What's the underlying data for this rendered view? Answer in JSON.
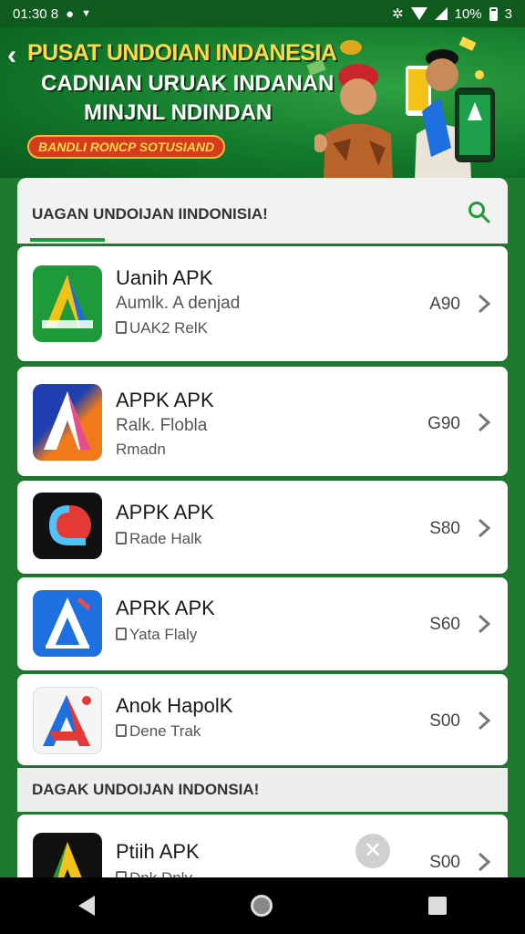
{
  "status_bar": {
    "time": "01:30 8",
    "battery_text": "10%",
    "extra": "3"
  },
  "banner": {
    "title": "PUSAT UNDOIAN INDANESIA",
    "subtitle_1": "CADNIAN URUAK INDANAN",
    "subtitle_2": "MINJNL NDINDAN",
    "promo_label": "BANDLI RONCP SOTUSIAND"
  },
  "list_header": {
    "label": "UAGAN UNDOIJAN IINDONISIA!"
  },
  "apps": [
    {
      "name": "Uanih APK",
      "desc_1": "Aumlk. A denjad",
      "desc_2": "UAK2 RelK",
      "price": "A90",
      "colors": [
        "#1e9a3a",
        "#f2c21b",
        "#1e6fd0"
      ]
    },
    {
      "name": "APPK APK",
      "desc_1": "Ralk. Flobla",
      "desc_2": "Rmadn",
      "price": "G90",
      "colors": [
        "#1e3fb0",
        "#f07a1a",
        "#e84d8a"
      ]
    },
    {
      "name": "APPK APK",
      "desc_1": "Rade Halk",
      "desc_2": "",
      "price": "S80",
      "colors": [
        "#111111",
        "#e53935",
        "#4fc3f7"
      ]
    },
    {
      "name": "APRK APK",
      "desc_1": "Yata Flaly",
      "desc_2": "",
      "price": "S60",
      "colors": [
        "#1e6fe0",
        "#e84d4d",
        "#ffffff"
      ]
    },
    {
      "name": "Anok HapolK",
      "desc_1": "Dene Trak",
      "desc_2": "",
      "price": "S00",
      "colors": [
        "#ffffff",
        "#e53935",
        "#1e6fe0"
      ]
    },
    {
      "name": "Ptiih APK",
      "desc_1": "Dnk Dnly",
      "desc_2": "",
      "price": "S00",
      "colors": [
        "#111111",
        "#1e9a3a",
        "#f2c21b"
      ]
    }
  ],
  "section_2": {
    "label": "DAGAK UNDOIJAN INDONSIA!"
  },
  "close_glyph": "✕",
  "theme": {
    "primary_green": "#1e7a2f",
    "accent_green": "#1e9a3a",
    "banner_yellow": "#ffd84a",
    "promo_red": "#d63b1e"
  }
}
